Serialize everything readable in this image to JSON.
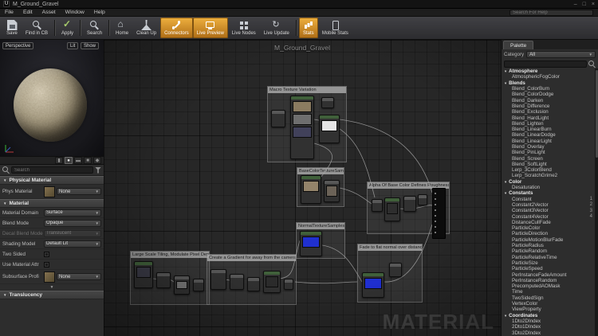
{
  "window": {
    "title": "M_Ground_Gravel",
    "controls": {
      "minimize": "–",
      "maximize": "□",
      "close": "×"
    }
  },
  "menubar": {
    "items": [
      "File",
      "Edit",
      "Asset",
      "Window",
      "Help"
    ],
    "help_search_placeholder": "Search For Help"
  },
  "toolbar": {
    "buttons": [
      {
        "label": "Save",
        "icon": "save-icon"
      },
      {
        "label": "Find in CB",
        "icon": "find-cb-icon"
      },
      {
        "label": "Apply",
        "icon": "apply-icon"
      },
      {
        "label": "Search",
        "icon": "search-icon"
      },
      {
        "label": "Home",
        "icon": "home-icon"
      },
      {
        "label": "Clean Up",
        "icon": "clean-icon"
      },
      {
        "label": "Connectors",
        "icon": "connectors-icon",
        "active": true
      },
      {
        "label": "Live Preview",
        "icon": "preview-icon",
        "active": true
      },
      {
        "label": "Live Nodes",
        "icon": "nodes-icon"
      },
      {
        "label": "Live Update",
        "icon": "update-icon"
      },
      {
        "label": "Stats",
        "icon": "stats-icon",
        "active": true
      },
      {
        "label": "Mobile Stats",
        "icon": "mobile-icon"
      }
    ]
  },
  "viewport": {
    "perspective_label": "Perspective",
    "lit_label": "Lit",
    "show_label": "Show",
    "shapes": [
      {
        "name": "cylinder-shape-icon",
        "glyph": "▮"
      },
      {
        "name": "sphere-shape-icon",
        "glyph": "●",
        "active": true
      },
      {
        "name": "plane-shape-icon",
        "glyph": "▬"
      },
      {
        "name": "cube-shape-icon",
        "glyph": "■"
      },
      {
        "name": "mesh-shape-icon",
        "glyph": "◆"
      }
    ]
  },
  "details": {
    "search_placeholder": "Search",
    "sections": [
      {
        "title": "Physical Material",
        "rows": [
          {
            "label": "Phys Material",
            "value": "None",
            "type": "asset"
          }
        ]
      },
      {
        "title": "Material",
        "expander": true,
        "rows": [
          {
            "label": "Material Domain",
            "value": "Surface",
            "type": "dropdown"
          },
          {
            "label": "Blend Mode",
            "value": "Opaque",
            "type": "dropdown"
          },
          {
            "label": "Decal Blend Mode",
            "value": "Translucent",
            "type": "dropdown",
            "disabled": true
          },
          {
            "label": "Shading Model",
            "value": "Default Lit",
            "type": "dropdown"
          },
          {
            "label": "Two Sided",
            "value": false,
            "type": "checkbox"
          },
          {
            "label": "Use Material Attr",
            "value": false,
            "type": "checkbox"
          },
          {
            "label": "Subsurface Profi",
            "value": "None",
            "type": "asset"
          }
        ]
      },
      {
        "title": "Translucency",
        "rows": []
      }
    ]
  },
  "graph": {
    "title": "M_Ground_Gravel",
    "watermark": "MATERIAL",
    "comments": [
      {
        "label": "Macro Texture Variation"
      },
      {
        "label": "BaseColorTextureSamples"
      },
      {
        "label": "Alpha Of Base Color Defines Roughness"
      },
      {
        "label": "NormalTextureSamples"
      },
      {
        "label": "Large Scale Tiling, Modulate Pixel Depth with Noise"
      },
      {
        "label": "Create a Gradient for away from the camera"
      },
      {
        "label": "Fade to flat normal over distance"
      }
    ]
  },
  "palette": {
    "tab_label": "Palette",
    "category_label": "Category",
    "category_value": "All",
    "search_placeholder": "",
    "rows": [
      {
        "type": "header",
        "label": "Atmosphere"
      },
      {
        "type": "item",
        "label": "AtmosphericFogColor"
      },
      {
        "type": "header",
        "label": "Blends"
      },
      {
        "type": "item",
        "label": "Blend_ColorBurn"
      },
      {
        "type": "item",
        "label": "Blend_ColorDodge"
      },
      {
        "type": "item",
        "label": "Blend_Darken"
      },
      {
        "type": "item",
        "label": "Blend_Difference"
      },
      {
        "type": "item",
        "label": "Blend_Exclusion"
      },
      {
        "type": "item",
        "label": "Blend_HardLight"
      },
      {
        "type": "item",
        "label": "Blend_Lighten"
      },
      {
        "type": "item",
        "label": "Blend_LinearBurn"
      },
      {
        "type": "item",
        "label": "Blend_LinearDodge"
      },
      {
        "type": "item",
        "label": "Blend_LinearLight"
      },
      {
        "type": "item",
        "label": "Blend_Overlay"
      },
      {
        "type": "item",
        "label": "Blend_PinLight"
      },
      {
        "type": "item",
        "label": "Blend_Screen"
      },
      {
        "type": "item",
        "label": "Blend_SoftLight"
      },
      {
        "type": "item",
        "label": "Lerp_3ColorBlend"
      },
      {
        "type": "item",
        "label": "Lerp_ScratchGrime2"
      },
      {
        "type": "header",
        "label": "Color"
      },
      {
        "type": "item",
        "label": "Desaturation"
      },
      {
        "type": "header",
        "label": "Constants"
      },
      {
        "type": "item",
        "label": "Constant",
        "badge": "1"
      },
      {
        "type": "item",
        "label": "Constant2Vector",
        "badge": "2"
      },
      {
        "type": "item",
        "label": "Constant3Vector",
        "badge": "3"
      },
      {
        "type": "item",
        "label": "Constant4Vector",
        "badge": "4"
      },
      {
        "type": "item",
        "label": "DistanceCullFade"
      },
      {
        "type": "item",
        "label": "ParticleColor"
      },
      {
        "type": "item",
        "label": "ParticleDirection"
      },
      {
        "type": "item",
        "label": "ParticleMotionBlurFade"
      },
      {
        "type": "item",
        "label": "ParticleRadius"
      },
      {
        "type": "item",
        "label": "ParticleRandom"
      },
      {
        "type": "item",
        "label": "ParticleRelativeTime"
      },
      {
        "type": "item",
        "label": "ParticleSize"
      },
      {
        "type": "item",
        "label": "ParticleSpeed"
      },
      {
        "type": "item",
        "label": "PerInstanceFadeAmount"
      },
      {
        "type": "item",
        "label": "PerInstanceRandom"
      },
      {
        "type": "item",
        "label": "PrecomputedAOMask"
      },
      {
        "type": "item",
        "label": "Time"
      },
      {
        "type": "item",
        "label": "TwoSidedSign"
      },
      {
        "type": "item",
        "label": "VertexColor"
      },
      {
        "type": "item",
        "label": "ViewProperty"
      },
      {
        "type": "header",
        "label": "Coordinates"
      },
      {
        "type": "item",
        "label": "1Dto2DIndex"
      },
      {
        "type": "item",
        "label": "2Dto1DIndex"
      },
      {
        "type": "item",
        "label": "3Dto2DIndex"
      }
    ]
  }
}
